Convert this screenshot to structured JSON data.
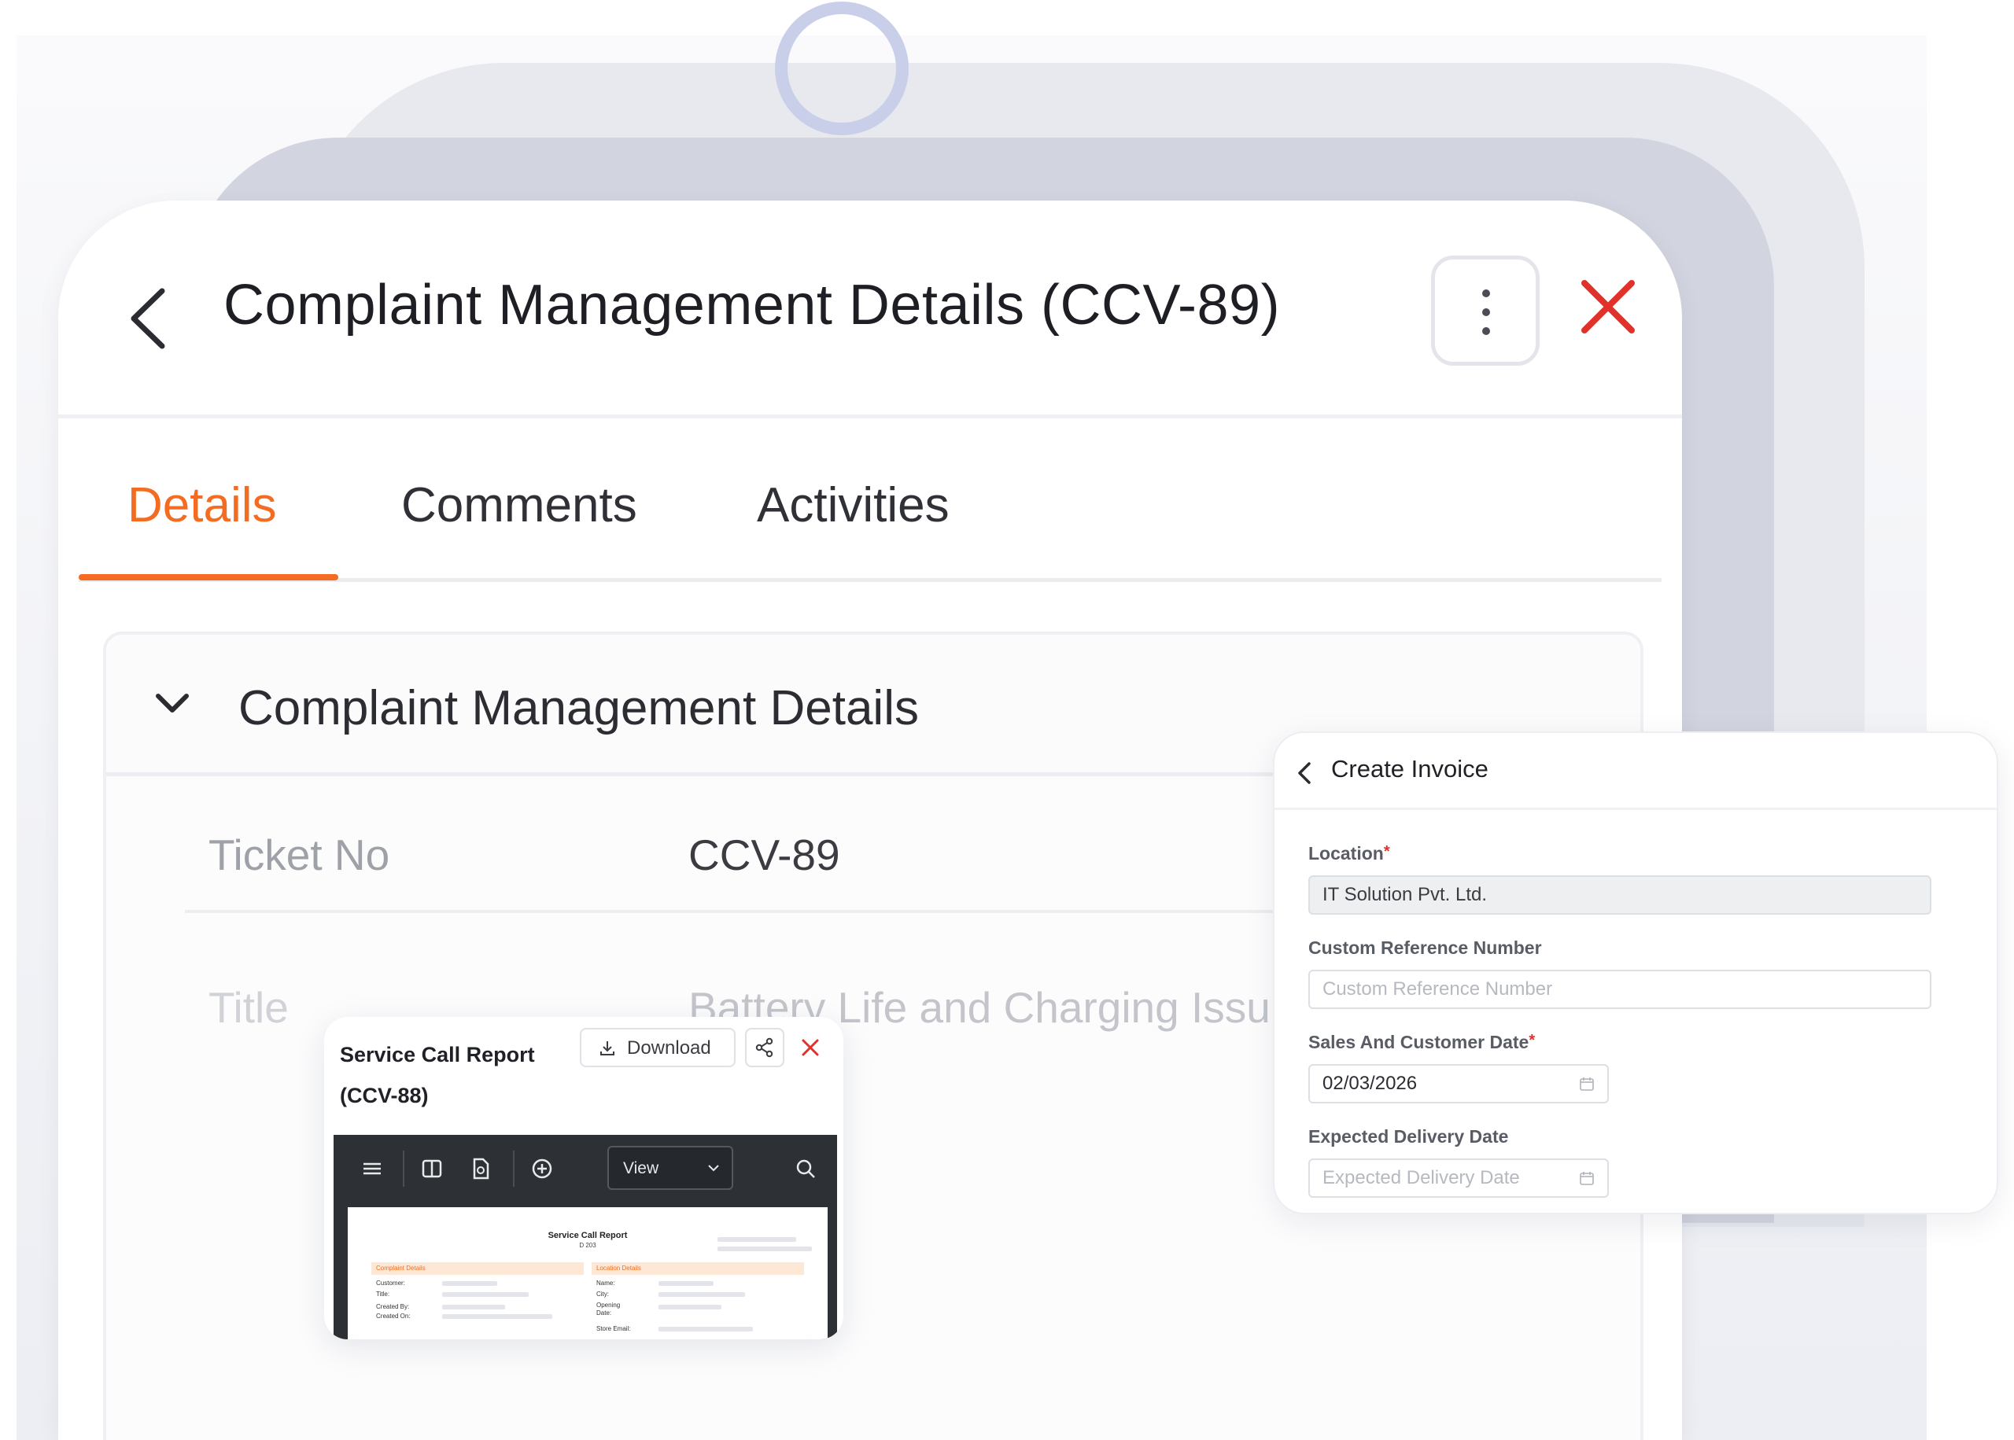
{
  "main": {
    "title": "Complaint Management Details (CCV-89)",
    "tabs": [
      {
        "label": "Details",
        "active": true
      },
      {
        "label": "Comments",
        "active": false
      },
      {
        "label": "Activities",
        "active": false
      }
    ],
    "section_title": "Complaint Management Details",
    "fields": [
      {
        "label": "Ticket No",
        "value": "CCV-89"
      },
      {
        "label": "Title",
        "value": "Battery Life and Charging Issu"
      }
    ]
  },
  "invoice": {
    "title": "Create Invoice",
    "fields": [
      {
        "label": "Location",
        "required": true,
        "value": "IT Solution Pvt. Ltd.",
        "placeholder": ""
      },
      {
        "label": "Custom Reference Number",
        "required": false,
        "value": "",
        "placeholder": "Custom Reference Number"
      },
      {
        "label": "Sales And Customer Date",
        "required": true,
        "value": "02/03/2026",
        "placeholder": ""
      },
      {
        "label": "Expected Delivery Date",
        "required": false,
        "value": "",
        "placeholder": "Expected Delivery Date"
      }
    ],
    "required_mark": "*"
  },
  "report": {
    "title_line1": "Service Call Report",
    "title_line2": "(CCV-88)",
    "download_label": "Download",
    "view_select": "View",
    "doc": {
      "title": "Service Call Report",
      "subtitle": "D 203",
      "left_section": "Complaint Details",
      "right_section": "Location Details",
      "left_labels": [
        "Customer:",
        "Title:",
        "Created By:",
        "Created On:"
      ],
      "right_labels": [
        "Name:",
        "City:",
        "Opening",
        "Date:",
        "Store Email:"
      ]
    }
  },
  "colors": {
    "accent": "#f36c21",
    "close": "#e0322a",
    "ring": "#c9cfe9"
  }
}
